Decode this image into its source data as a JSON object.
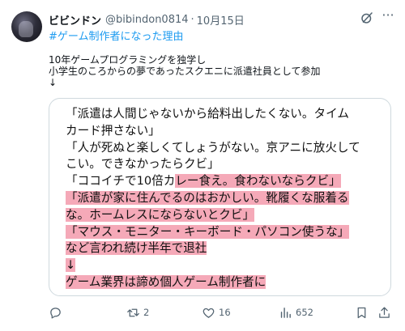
{
  "tweet": {
    "display_name": "ビビンドン",
    "handle": "@bibindon0814",
    "separator": "·",
    "date": "10月15日",
    "more_label": "···",
    "hashtag": "#ゲーム制作者になった理由",
    "body_lines": [
      "10年ゲームプログラミングを独学し",
      "小学生のころからの夢であったスクエニに派遣社員として参加",
      "↓"
    ]
  },
  "quote": {
    "lines": [
      {
        "plain": "「派遣は人間じゃないから給料出したくない。タイム",
        "hl": ""
      },
      {
        "plain": "カード押さない」",
        "hl": ""
      },
      {
        "plain": "「人が死ぬと楽しくてしょうがない。京アニに放火して",
        "hl": ""
      },
      {
        "plain": "こい。できなかったらクビ」",
        "hl": ""
      },
      {
        "plain": "「ココイチで10倍カ",
        "hl": "レー食え。食わないならクビ」"
      },
      {
        "plain": "",
        "hl": "「派遣が家に住んでるのはおかしい。靴履くな服着る"
      },
      {
        "plain": "",
        "hl": "な。ホームレスにならないとクビ」"
      },
      {
        "plain": "",
        "hl": "「マウス・モニター・キーボード・パソコン使うな」"
      },
      {
        "plain": "",
        "hl": "など言われ続け半年で退社"
      },
      {
        "plain": "",
        "hl": "↓"
      },
      {
        "plain": "",
        "hl": "ゲーム業界は諦め個人ゲーム制作者に"
      }
    ]
  },
  "actions": {
    "reply_count": "",
    "retweet_count": "2",
    "like_count": "16",
    "views_count": "652"
  },
  "colors": {
    "link": "#1d9bf0",
    "muted": "#536471",
    "highlight": "#f5a9b8"
  }
}
